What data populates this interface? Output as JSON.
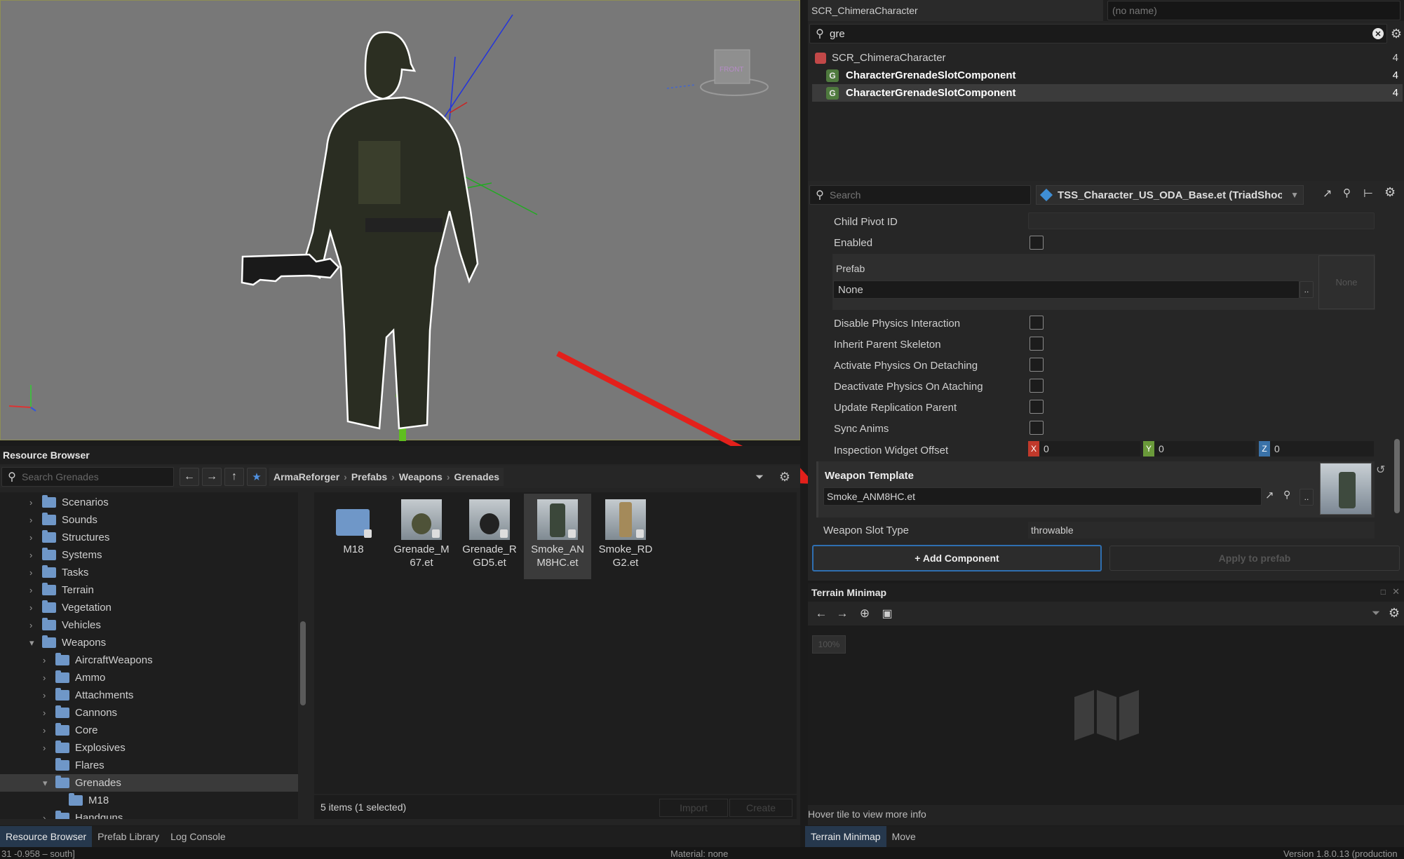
{
  "viewport": {
    "gizmo_label": "FRONT"
  },
  "top_panel": {
    "entity_type": "SCR_ChimeraCharacter",
    "entity_name": "(no name)",
    "search_value": "gre",
    "tree": [
      {
        "label": "SCR_ChimeraCharacter",
        "count": "4"
      },
      {
        "label": "CharacterGrenadeSlotComponent",
        "count": "4"
      },
      {
        "label": "CharacterGrenadeSlotComponent",
        "count": "4"
      }
    ]
  },
  "inspector": {
    "search_placeholder": "Search",
    "prefab_name": "TSS_Character_US_ODA_Base.et (TriadShoo",
    "props": {
      "child_pivot": "Child Pivot ID",
      "enabled": "Enabled",
      "prefab": "Prefab",
      "prefab_value": "None",
      "prefab_preview": "None",
      "disable_physics": "Disable Physics Interaction",
      "inherit_skeleton": "Inherit Parent Skeleton",
      "activate_physics": "Activate Physics On Detaching",
      "deactivate_physics": "Deactivate Physics On Ataching",
      "update_replication": "Update Replication Parent",
      "sync_anims": "Sync Anims",
      "inspection_offset": "Inspection Widget Offset",
      "x_label": "X",
      "x_value": "0",
      "y_label": "Y",
      "y_value": "0",
      "z_label": "Z",
      "z_value": "0",
      "weapon_template": "Weapon Template",
      "weapon_template_value": "Smoke_ANM8HC.et",
      "weapon_slot_type": "Weapon Slot Type",
      "weapon_slot_type_value": "throwable"
    },
    "add_component": "+ Add Component",
    "apply_prefab": "Apply to prefab"
  },
  "minimap": {
    "title": "Terrain Minimap",
    "zoom": "100%",
    "hint": "Hover tile to view more info",
    "tabs": [
      "Terrain Minimap",
      "Move"
    ]
  },
  "resource_browser": {
    "title": "Resource Browser",
    "search_placeholder": "Search Grenades",
    "breadcrumb": [
      "ArmaReforger",
      "Prefabs",
      "Weapons",
      "Grenades"
    ],
    "tree": [
      {
        "label": "Scenarios",
        "depth": 0,
        "expanded": false
      },
      {
        "label": "Sounds",
        "depth": 0,
        "expanded": false
      },
      {
        "label": "Structures",
        "depth": 0,
        "expanded": false
      },
      {
        "label": "Systems",
        "depth": 0,
        "expanded": false
      },
      {
        "label": "Tasks",
        "depth": 0,
        "expanded": false
      },
      {
        "label": "Terrain",
        "depth": 0,
        "expanded": false
      },
      {
        "label": "Vegetation",
        "depth": 0,
        "expanded": false
      },
      {
        "label": "Vehicles",
        "depth": 0,
        "expanded": false
      },
      {
        "label": "Weapons",
        "depth": 0,
        "expanded": true
      },
      {
        "label": "AircraftWeapons",
        "depth": 1,
        "expanded": false
      },
      {
        "label": "Ammo",
        "depth": 1,
        "expanded": false
      },
      {
        "label": "Attachments",
        "depth": 1,
        "expanded": false
      },
      {
        "label": "Cannons",
        "depth": 1,
        "expanded": false
      },
      {
        "label": "Core",
        "depth": 1,
        "expanded": false
      },
      {
        "label": "Explosives",
        "depth": 1,
        "expanded": false
      },
      {
        "label": "Flares",
        "depth": 1,
        "expanded": null
      },
      {
        "label": "Grenades",
        "depth": 1,
        "expanded": true
      },
      {
        "label": "M18",
        "depth": 2,
        "expanded": null
      },
      {
        "label": "Handguns",
        "depth": 1,
        "expanded": false
      }
    ],
    "assets": [
      {
        "label": "M18",
        "kind": "folder"
      },
      {
        "label": "Grenade_M67.et",
        "kind": "grenade_m67"
      },
      {
        "label": "Grenade_RGD5.et",
        "kind": "grenade_rgd5"
      },
      {
        "label": "Smoke_ANM8HC.et",
        "kind": "smoke_anm8",
        "selected": true
      },
      {
        "label": "Smoke_RDG2.et",
        "kind": "smoke_rdg2"
      }
    ],
    "status": "5 items (1 selected)",
    "import_label": "Import",
    "create_label": "Create",
    "tabs": [
      "Resource Browser",
      "Prefab Library",
      "Log Console"
    ]
  },
  "status_bar": {
    "left": "31 -0.958 – south]",
    "middle": "Material: none",
    "right": "Version 1.8.0.13 (production"
  },
  "colors": {
    "accent": "#2f6fb1",
    "arrow": "#e3201b",
    "x_axis": "#c0392b",
    "y_axis": "#6a9a3a",
    "z_axis": "#3a72a8"
  }
}
